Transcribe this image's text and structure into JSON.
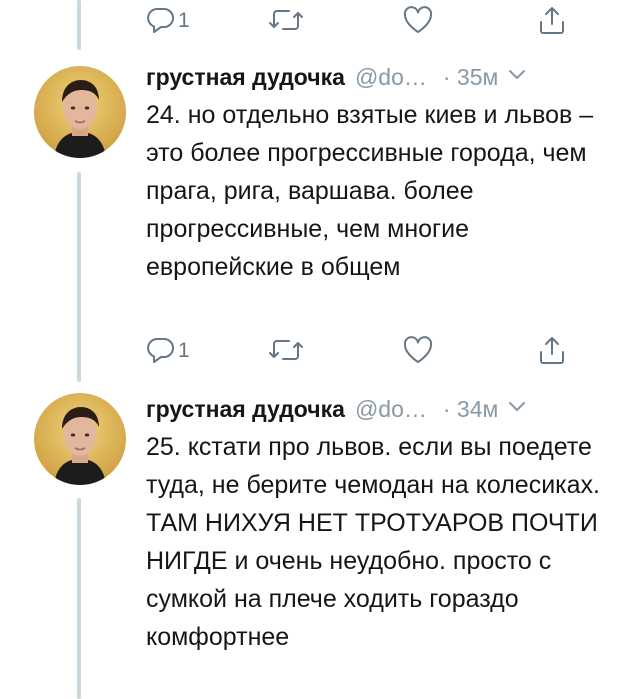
{
  "top_actions": {
    "reply_count": "1"
  },
  "tweets": [
    {
      "name": "грустная дудочка",
      "handle": "@do…",
      "time": "· 35м",
      "text": "24. но отдельно взятые киев и львов – это более прогрессивные города, чем прага, рига, варшава. более прогрессивные, чем многие европейские в общем",
      "reply_count": "1"
    },
    {
      "name": "грустная дудочка",
      "handle": "@do…",
      "time": "· 34м",
      "text": "25. кстати про львов. если вы поедете туда, не берите чемодан на колесиках. ТАМ НИХУЯ НЕТ ТРОТУАРОВ ПОЧТИ НИГДЕ и очень неудобно. просто с сумкой на плече ходить гораздо комфортнее"
    }
  ],
  "icons": {
    "reply": "reply-icon",
    "retweet": "retweet-icon",
    "like": "like-icon",
    "share": "share-icon",
    "chevron": "chevron-down-icon"
  },
  "colors": {
    "text": "#14171a",
    "secondary": "#8899a6",
    "icon": "#657786",
    "thread_line": "#ccd6dd"
  }
}
